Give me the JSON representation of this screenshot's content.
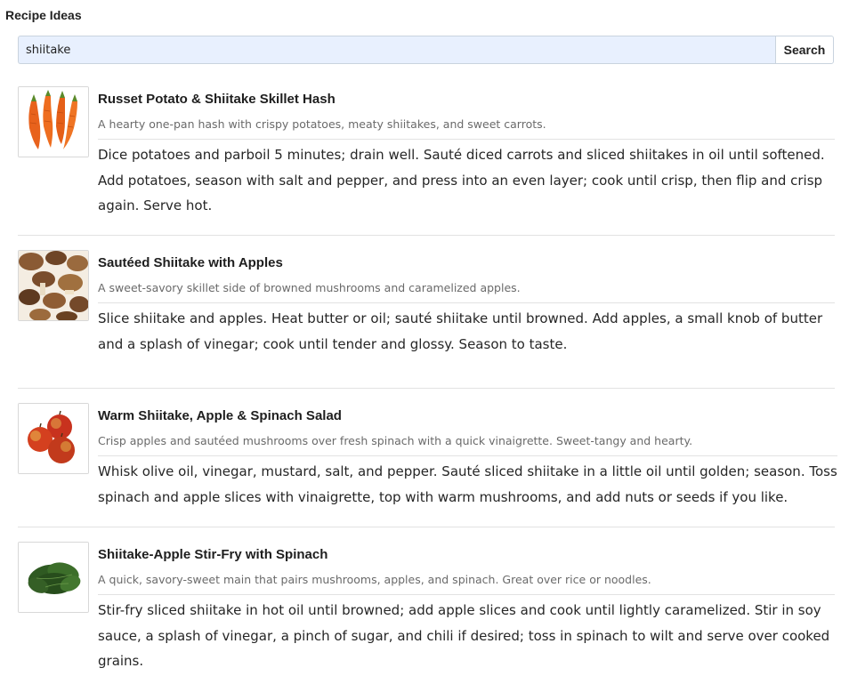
{
  "page": {
    "title": "Recipe Ideas"
  },
  "search": {
    "value": "shiitake",
    "placeholder": "",
    "button_label": "Search"
  },
  "colors": {
    "search_input_bg": "#e8f0fe",
    "border": "#c9d3de",
    "text": "#222222",
    "muted": "#6a6a6a"
  },
  "recipes": [
    {
      "image": "carrots-image",
      "title": "Russet Potato & Shiitake Skillet Hash",
      "description": "A hearty one-pan hash with crispy potatoes, meaty shiitakes, and sweet carrots.",
      "steps_lines": [
        "Dice potatoes and parboil 5 minutes; drain well. Sauté diced carrots and sliced shiitakes in oil until softened.",
        "Add potatoes, season with salt and pepper, and press into an even layer; cook until crisp, then flip and crisp",
        "again. Serve hot."
      ]
    },
    {
      "image": "shiitake-mushrooms-image",
      "title": "Sautéed Shiitake with Apples",
      "description": "A sweet-savory skillet side of browned mushrooms and caramelized apples.",
      "steps_lines": [
        "Slice shiitake and apples. Heat butter or oil; sauté shiitake until browned. Add apples, a small knob of butter",
        "and a splash of vinegar; cook until tender and glossy. Season to taste."
      ]
    },
    {
      "image": "apples-image",
      "title": "Warm Shiitake, Apple & Spinach Salad",
      "description": "Crisp apples and sautéed mushrooms over fresh spinach with a quick vinaigrette. Sweet-tangy and hearty.",
      "steps_lines": [
        "Whisk olive oil, vinegar, mustard, salt, and pepper. Sauté sliced shiitake in a little oil until golden; season. Toss",
        "spinach and apple slices with vinaigrette, top with warm mushrooms, and add nuts or seeds if you like."
      ]
    },
    {
      "image": "spinach-image",
      "title": "Shiitake-Apple Stir-Fry with Spinach",
      "description": "A quick, savory-sweet main that pairs mushrooms, apples, and spinach. Great over rice or noodles.",
      "steps_lines": [
        "Stir-fry sliced shiitake in hot oil until browned; add apple slices and cook until lightly caramelized. Stir in soy",
        "sauce, a splash of vinegar, a pinch of sugar, and chili if desired; toss in spinach to wilt and serve over cooked",
        "grains."
      ]
    }
  ]
}
